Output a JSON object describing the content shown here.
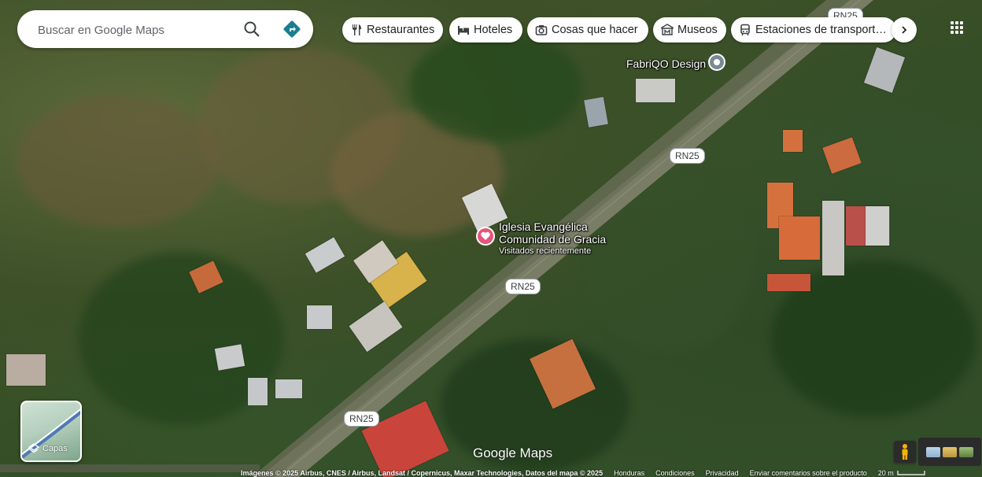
{
  "search": {
    "placeholder": "Buscar en Google Maps",
    "search_icon": "search-icon",
    "directions_icon": "directions-icon"
  },
  "chips": [
    {
      "label": "Restaurantes",
      "icon": "restaurant-icon"
    },
    {
      "label": "Hoteles",
      "icon": "hotel-icon"
    },
    {
      "label": "Cosas que hacer",
      "icon": "camera-icon"
    },
    {
      "label": "Museos",
      "icon": "museum-icon"
    },
    {
      "label": "Estaciones de transport…",
      "icon": "transit-icon"
    }
  ],
  "chips_more_icon": "chevron-right-icon",
  "apps_icon": "apps-grid-icon",
  "roads": {
    "shield_label": "RN25"
  },
  "places": [
    {
      "name": "FabriQO Design",
      "icon": "place-pin-icon"
    },
    {
      "name": "Iglesia Evangélica",
      "name_line2": "Comunidad de Gracia",
      "subtitle": "Visitados recientemente",
      "icon": "heart-pin-icon"
    }
  ],
  "layers": {
    "label": "Capas",
    "icon": "layers-icon"
  },
  "logo": "Google Maps",
  "footer": {
    "imagery": "Imágenes © 2025 Airbus, CNES / Airbus, Landsat / Copernicus, Maxar Technologies, Datos del mapa © 2025",
    "country": "Honduras",
    "terms": "Condiciones",
    "privacy": "Privacidad",
    "feedback": "Enviar comentarios sobre el producto",
    "scale": "20 m"
  },
  "colors": {
    "directions": "#1a7f8e",
    "heart_pin": "#e8557a"
  }
}
